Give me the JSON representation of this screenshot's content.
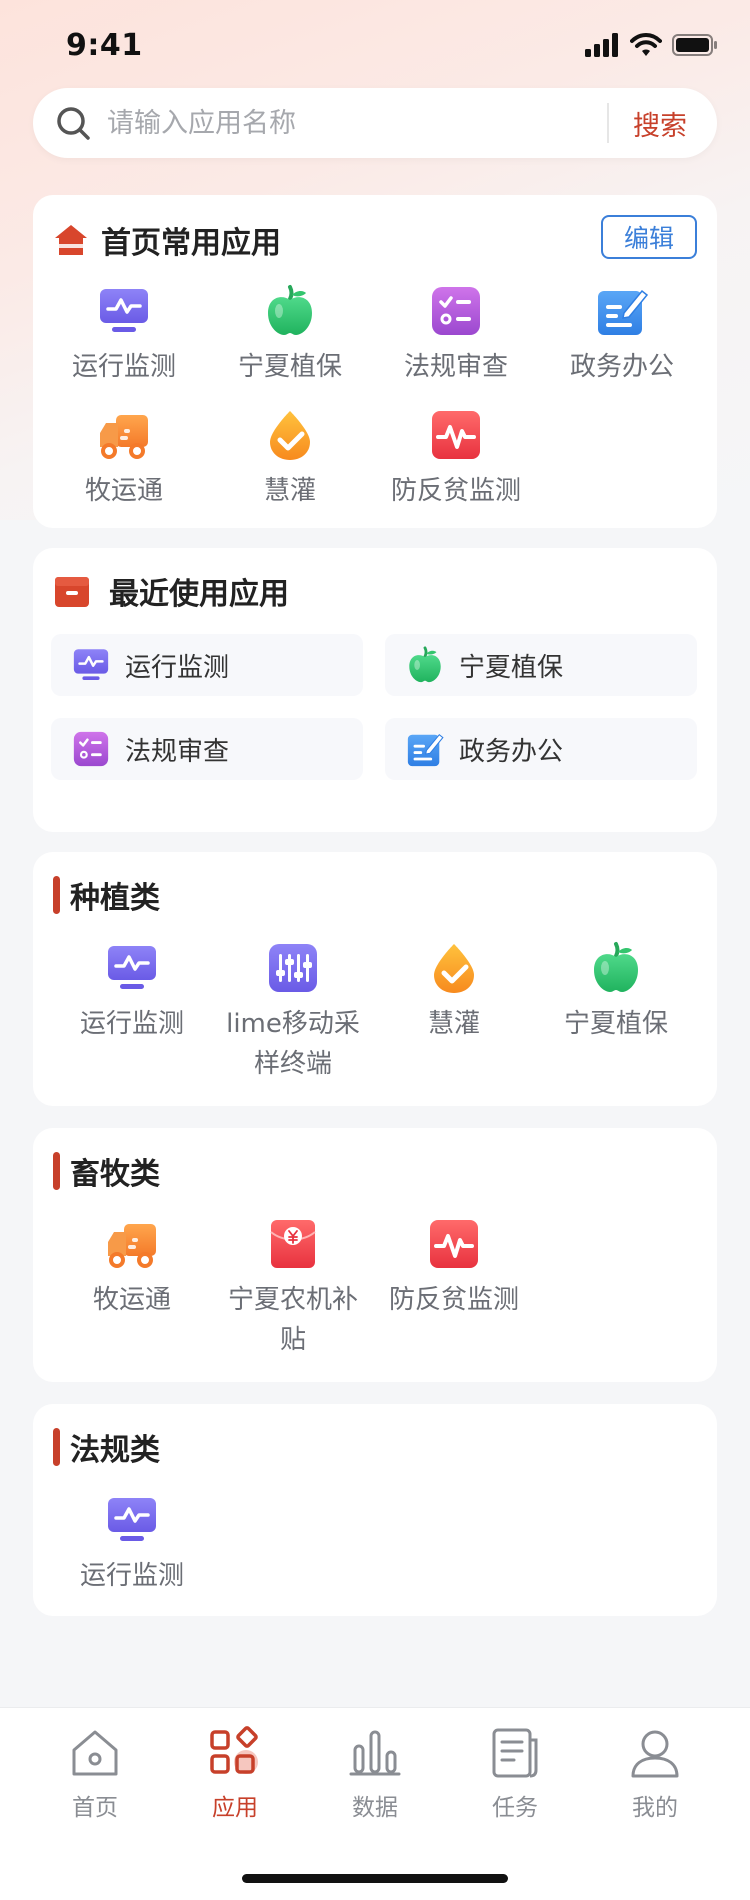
{
  "status_bar": {
    "time": "9:41"
  },
  "search": {
    "placeholder": "请输入应用名称",
    "button_label": "搜索"
  },
  "favorites": {
    "title": "首页常用应用",
    "edit_label": "编辑",
    "items": [
      {
        "label": "运行监测",
        "icon": "monitor-icon"
      },
      {
        "label": "宁夏植保",
        "icon": "apple-icon"
      },
      {
        "label": "法规审查",
        "icon": "checklist-icon"
      },
      {
        "label": "政务办公",
        "icon": "document-edit-icon"
      },
      {
        "label": "牧运通",
        "icon": "truck-icon"
      },
      {
        "label": "慧灌",
        "icon": "water-drop-icon"
      },
      {
        "label": "防反贫监测",
        "icon": "heartbeat-icon"
      }
    ]
  },
  "recent": {
    "title": "最近使用应用",
    "items": [
      {
        "label": "运行监测",
        "icon": "monitor-icon"
      },
      {
        "label": "宁夏植保",
        "icon": "apple-icon"
      },
      {
        "label": "法规审查",
        "icon": "checklist-icon"
      },
      {
        "label": "政务办公",
        "icon": "document-edit-icon"
      }
    ]
  },
  "planting": {
    "title": "种植类",
    "items": [
      {
        "label": "运行监测",
        "icon": "monitor-icon"
      },
      {
        "label": "lime移动采样终端",
        "icon": "sliders-icon"
      },
      {
        "label": "慧灌",
        "icon": "water-drop-icon"
      },
      {
        "label": "宁夏植保",
        "icon": "apple-icon"
      }
    ]
  },
  "livestock": {
    "title": "畜牧类",
    "items": [
      {
        "label": "牧运通",
        "icon": "truck-icon"
      },
      {
        "label": "宁夏农机补贴",
        "icon": "red-envelope-icon"
      },
      {
        "label": "防反贫监测",
        "icon": "heartbeat-icon"
      }
    ]
  },
  "regulation": {
    "title": "法规类",
    "items": [
      {
        "label": "运行监测",
        "icon": "monitor-icon"
      }
    ]
  },
  "tab_bar": {
    "tabs": [
      {
        "label": "首页",
        "icon": "home-icon"
      },
      {
        "label": "应用",
        "icon": "apps-icon"
      },
      {
        "label": "数据",
        "icon": "bar-chart-icon"
      },
      {
        "label": "任务",
        "icon": "task-icon"
      },
      {
        "label": "我的",
        "icon": "user-icon"
      }
    ],
    "active": "应用"
  },
  "colors": {
    "accent": "#c7402a",
    "edit_blue": "#3b7fd9",
    "monitor_purple": "#7b6ef0",
    "apple_green": "#2fc36e",
    "checklist_violet": "#b45ad8",
    "doc_blue": "#3d8ff0",
    "orange": "#f7923a",
    "red": "#f0454f"
  }
}
